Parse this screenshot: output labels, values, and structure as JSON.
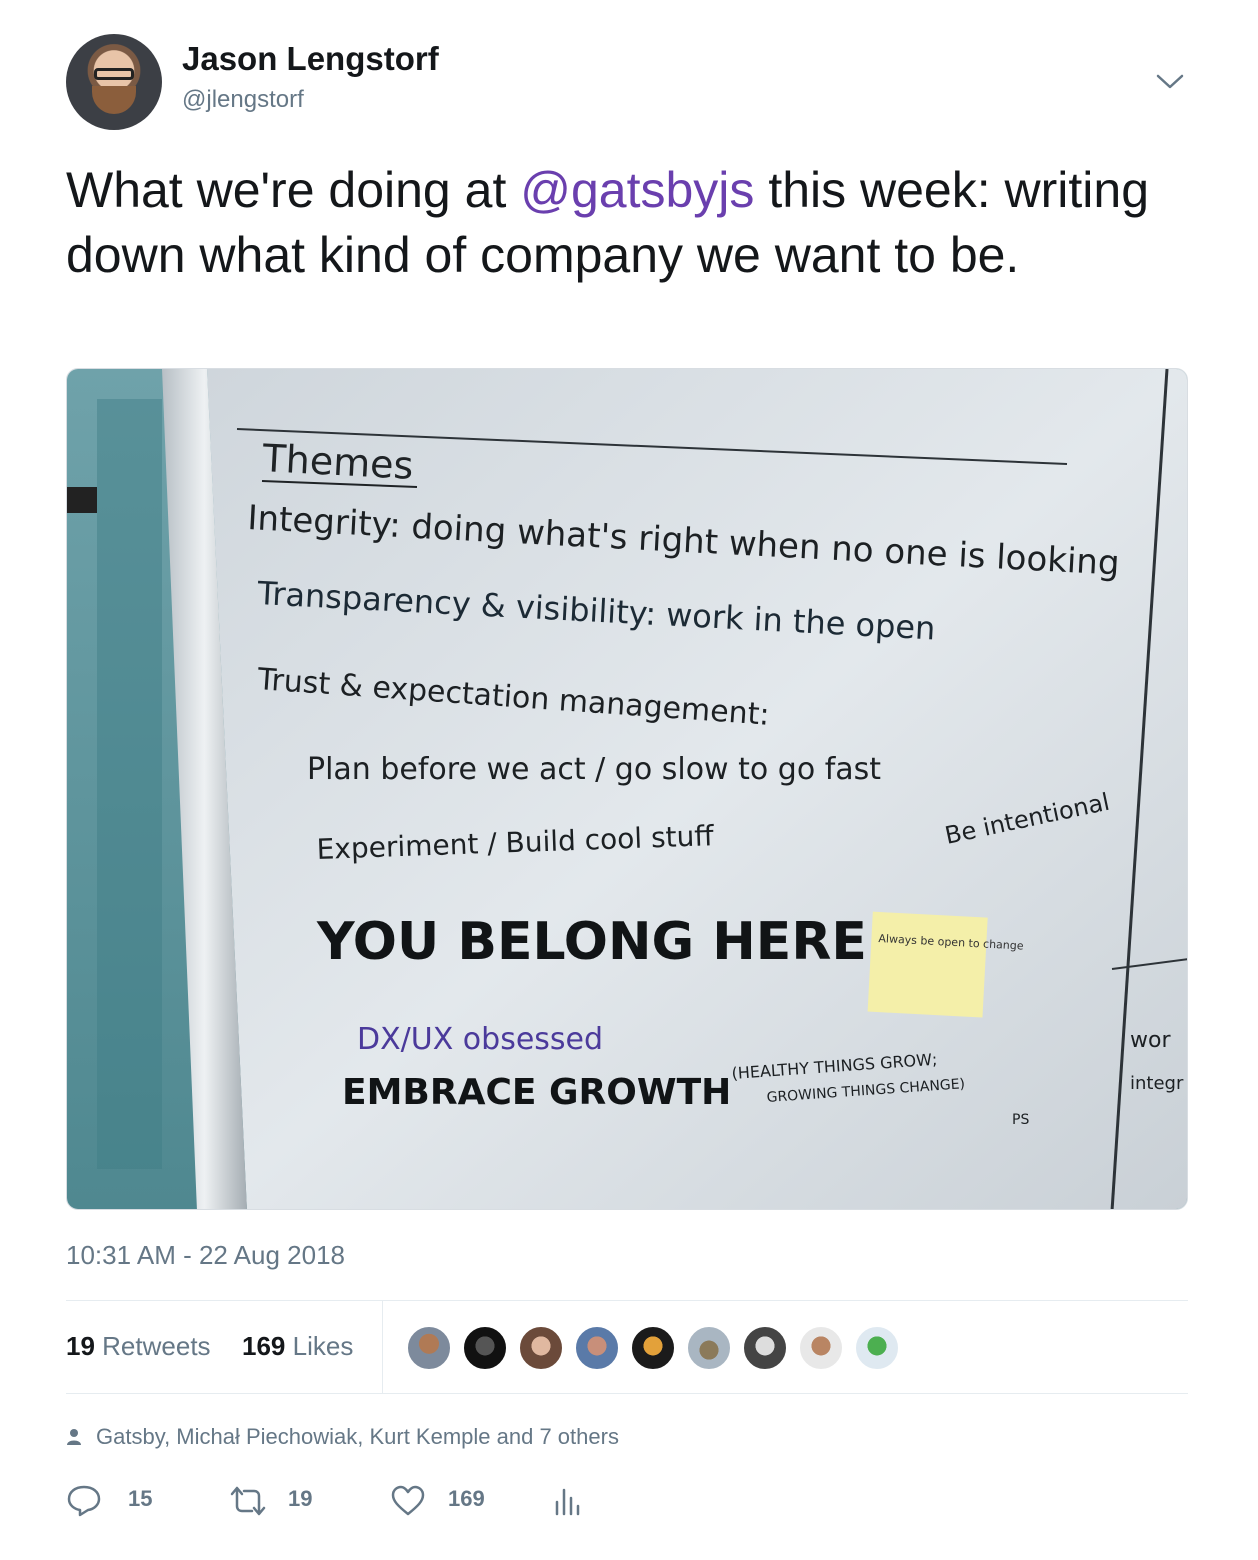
{
  "author": {
    "name": "Jason Lengstorf",
    "handle": "@jlengstorf"
  },
  "tweet": {
    "text_before": "What we're doing at ",
    "mention": "@gatsbyjs",
    "text_after": " this week: writing down what kind of company we want to be."
  },
  "whiteboard": {
    "heading": "Themes",
    "line1": "Integrity: doing what's right when no one is looking",
    "line2": "Transparency & visibility: work in the open",
    "line3": "Trust & expectation management:",
    "line4": "Plan before we act / go slow to go fast",
    "line5": "Experiment / Build cool stuff",
    "side_note": "Be intentional",
    "line6": "YOU BELONG HERE.",
    "sticky": "Always be open to change",
    "line7": "DX/UX obsessed",
    "line8": "EMBRACE GROWTH",
    "line8_note_a": "(HEALTHY THINGS GROW;",
    "line8_note_b": "GROWING THINGS CHANGE)",
    "initials": "PS",
    "right_fragment_1": "wor",
    "right_fragment_2": "integr"
  },
  "timestamp": "10:31 AM - 22 Aug 2018",
  "stats": {
    "retweets_count": "19",
    "retweets_label": "Retweets",
    "likes_count": "169",
    "likes_label": "Likes"
  },
  "liked_by": "Gatsby, Michał Piechowiak, Kurt Kemple and 7 others",
  "actions": {
    "reply_count": "15",
    "retweet_count": "19",
    "like_count": "169"
  },
  "colors": {
    "mention": "#6a3fae",
    "secondary_text": "#657786",
    "primary_text": "#14171a"
  },
  "icons": [
    "chevron-down-icon",
    "person-icon",
    "reply-icon",
    "retweet-icon",
    "heart-icon",
    "analytics-icon"
  ]
}
